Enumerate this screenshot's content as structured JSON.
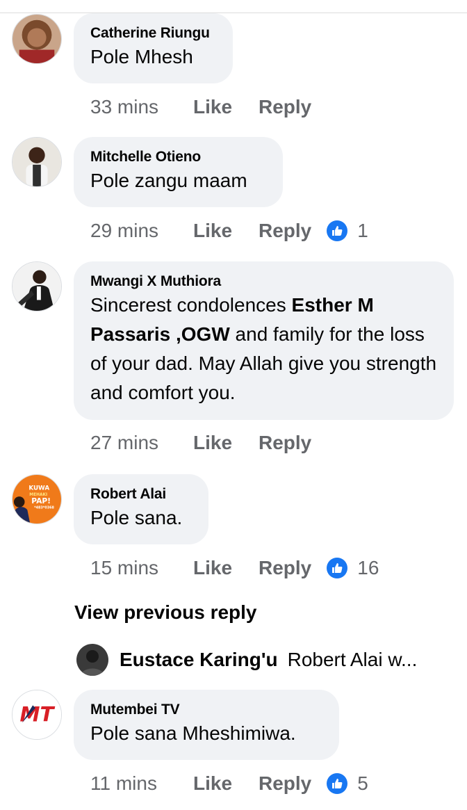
{
  "comments": [
    {
      "author": "Catherine Riungu",
      "text": "Pole Mhesh",
      "time": "33 mins",
      "like_label": "Like",
      "reply_label": "Reply",
      "reactions": null
    },
    {
      "author": "Mitchelle Otieno",
      "text": "Pole zangu maam",
      "time": "29 mins",
      "like_label": "Like",
      "reply_label": "Reply",
      "reactions": "1"
    },
    {
      "author": "Mwangi X Muthiora",
      "text_parts": [
        "Sincerest condolences ",
        "Esther M Passaris ,OGW",
        " and family for the loss of your dad. May Allah give you strength and comfort you."
      ],
      "time": "27 mins",
      "like_label": "Like",
      "reply_label": "Reply",
      "reactions": null
    },
    {
      "author": "Robert Alai",
      "text": "Pole sana.",
      "time": "15 mins",
      "like_label": "Like",
      "reply_label": "Reply",
      "reactions": "16",
      "avatar_text": [
        "KUWA",
        "MEHAKI",
        "PAP!",
        "*483*0368"
      ]
    },
    {
      "author": "Mutembei TV",
      "text": "Pole sana Mheshimiwa.",
      "time": "11 mins",
      "like_label": "Like",
      "reply_label": "Reply",
      "reactions": "5",
      "avatar_text": "MT"
    }
  ],
  "view_previous": "View previous reply",
  "reply_preview": {
    "author": "Eustace Karing'u",
    "text": "Robert Alai w..."
  },
  "colors": {
    "bubble": "#f0f2f5",
    "meta_text": "#65676b",
    "like_blue": "#1877f2",
    "text": "#050505"
  },
  "icons": {
    "reaction": "like-thumb-icon"
  }
}
